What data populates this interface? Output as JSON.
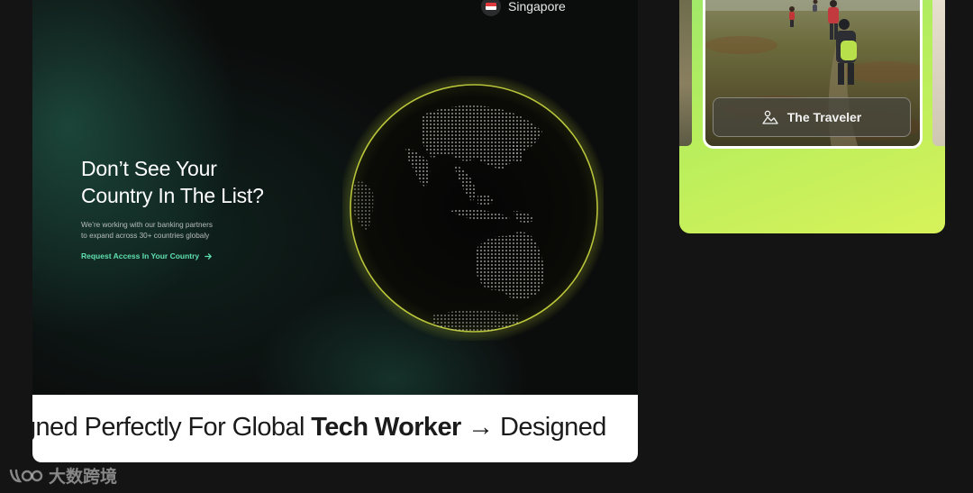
{
  "location": {
    "label": "Singapore",
    "flag_icon": "singapore-flag-icon"
  },
  "hero": {
    "headline_line1": "Don’t See Your",
    "headline_line2": "Country In The List?",
    "subtext_line1": "We’re working with our banking partners",
    "subtext_line2": "to expand across 30+ countries globaly",
    "cta_label": "Request Access In Your Country",
    "cta_icon": "arrow-right-icon",
    "accent_color": "#5fe0b0"
  },
  "marquee": {
    "part1": "gned Perfectly For Global ",
    "bold": "Tech Worker",
    "arrow": "→",
    "part2": " Designed"
  },
  "side_card": {
    "button_label": "The Traveler",
    "button_icon": "mountain-person-icon",
    "gradient_start": "#9fe86a",
    "gradient_end": "#d7f25a"
  },
  "watermark": {
    "text": "大数跨境",
    "logo_icon": "brand-logo-icon"
  }
}
